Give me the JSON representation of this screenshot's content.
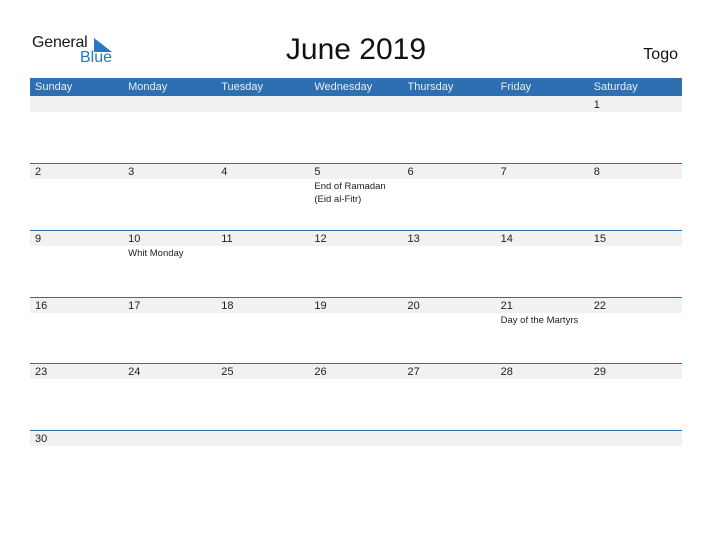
{
  "logo": {
    "general": "General",
    "blue": "Blue"
  },
  "header": {
    "title": "June 2019",
    "country": "Togo"
  },
  "colors": {
    "accent": "#2e6fb1",
    "band": "#f1f1f1",
    "logo_blue": "#2a78c2"
  },
  "weekdays": [
    "Sunday",
    "Monday",
    "Tuesday",
    "Wednesday",
    "Thursday",
    "Friday",
    "Saturday"
  ],
  "weeks": [
    [
      {
        "day": ""
      },
      {
        "day": ""
      },
      {
        "day": ""
      },
      {
        "day": ""
      },
      {
        "day": ""
      },
      {
        "day": ""
      },
      {
        "day": "1"
      }
    ],
    [
      {
        "day": "2"
      },
      {
        "day": "3"
      },
      {
        "day": "4"
      },
      {
        "day": "5",
        "event": "End of Ramadan (Eid al-Fitr)"
      },
      {
        "day": "6"
      },
      {
        "day": "7"
      },
      {
        "day": "8"
      }
    ],
    [
      {
        "day": "9"
      },
      {
        "day": "10",
        "event": "Whit Monday"
      },
      {
        "day": "11"
      },
      {
        "day": "12"
      },
      {
        "day": "13"
      },
      {
        "day": "14"
      },
      {
        "day": "15"
      }
    ],
    [
      {
        "day": "16"
      },
      {
        "day": "17"
      },
      {
        "day": "18"
      },
      {
        "day": "19"
      },
      {
        "day": "20"
      },
      {
        "day": "21",
        "event": "Day of the Martyrs"
      },
      {
        "day": "22"
      }
    ],
    [
      {
        "day": "23"
      },
      {
        "day": "24"
      },
      {
        "day": "25"
      },
      {
        "day": "26"
      },
      {
        "day": "27"
      },
      {
        "day": "28"
      },
      {
        "day": "29"
      }
    ],
    [
      {
        "day": "30"
      },
      {
        "day": ""
      },
      {
        "day": ""
      },
      {
        "day": ""
      },
      {
        "day": ""
      },
      {
        "day": ""
      },
      {
        "day": ""
      }
    ]
  ]
}
